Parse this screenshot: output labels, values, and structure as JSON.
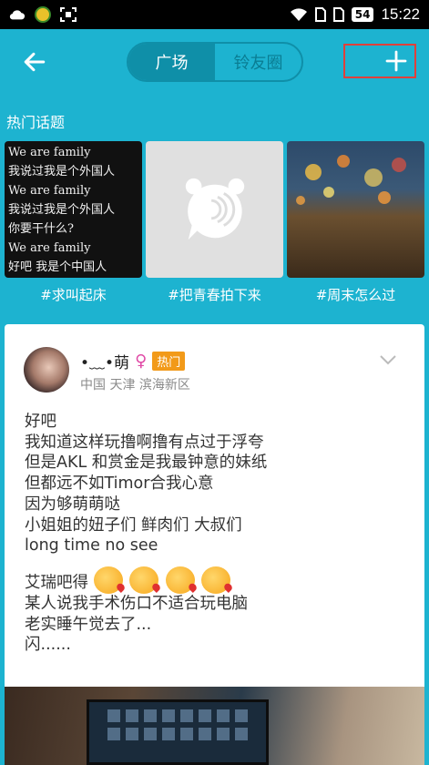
{
  "status_bar": {
    "time": "15:22",
    "battery": "54",
    "icons": [
      "cloud-icon",
      "app-icon",
      "screenshot-icon",
      "wifi-icon",
      "sim1-icon",
      "sim2-icon",
      "battery-icon"
    ]
  },
  "header": {
    "back_icon": "back-arrow-icon",
    "tabs": [
      {
        "label": "广场",
        "active": true
      },
      {
        "label": "铃友圈",
        "active": false
      }
    ],
    "add_icon": "plus-icon"
  },
  "hot_topics": {
    "title": "热门话题",
    "items": [
      {
        "label": "#求叫起床",
        "thumb_lines": [
          "We are family",
          "我说过我是个外国人",
          "We are family",
          "我说过我是个外国人",
          "你要干什么?",
          "We are family",
          "好吧 我是个中国人"
        ]
      },
      {
        "label": "#把青春拍下来"
      },
      {
        "label": "#周末怎么过"
      }
    ]
  },
  "post": {
    "username": "•﹏•萌",
    "gender_symbol": "♀",
    "badge": "热门",
    "location": "中国 天津 滨海新区",
    "lines": [
      "好吧",
      "我知道这样玩撸啊撸有点过于浮夸",
      "但是AKL 和赏金是我最钟意的妹纸",
      "但都远不如Timor合我心意",
      "因为够萌萌哒",
      "小姐姐的妞子们  鲜肉们  大叔们",
      "long time no see"
    ],
    "lines2_prefix": "艾瑞吧得",
    "lines2": [
      "某人说我手术伤口不适合玩电脑",
      "老实睡午觉去了...",
      "闪......"
    ]
  },
  "colors": {
    "header_bg": "#1db3d0",
    "tab_active": "#0f8fa8",
    "badge_hot": "#f29a19",
    "highlight_border": "#e0403a"
  }
}
